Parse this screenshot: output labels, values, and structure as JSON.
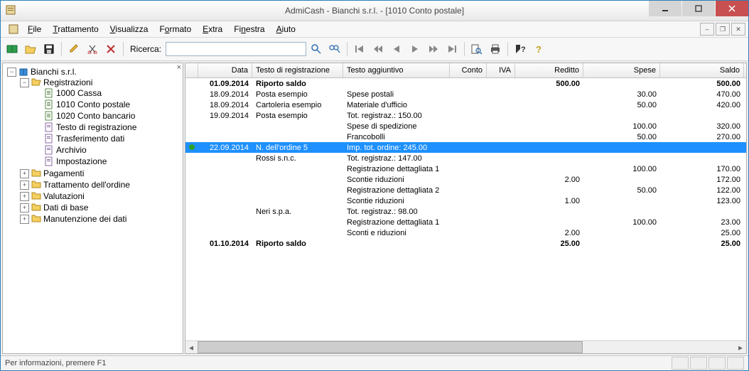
{
  "window": {
    "title": "AdmiCash - Bianchi s.r.l. - [1010 Conto postale]"
  },
  "menu": {
    "file": "File",
    "trattamento": "Trattamento",
    "visualizza": "Visualizza",
    "formato": "Formato",
    "extra": "Extra",
    "finestra": "Finestra",
    "aiuto": "Aiuto"
  },
  "toolbar": {
    "search_label": "Ricerca:",
    "search_value": ""
  },
  "tree": {
    "root": "Bianchi s.r.l.",
    "registrazioni": "Registrazioni",
    "items": [
      "1000 Cassa",
      "1010 Conto postale",
      "1020 Conto bancario",
      "Testo di registrazione",
      "Trasferimento dati",
      "Archivio",
      "Impostazione"
    ],
    "folders": [
      "Pagamenti",
      "Trattamento dell'ordine",
      "Valutazioni",
      "Dati di base",
      "Manutenzione dei dati"
    ]
  },
  "grid": {
    "headers": {
      "data": "Data",
      "testo": "Testo di registrazione",
      "agg": "Testo aggiuntivo",
      "conto": "Conto",
      "iva": "IVA",
      "reditto": "Reditto",
      "spese": "Spese",
      "saldo": "Saldo"
    },
    "rows": [
      {
        "mark": "",
        "data": "01.09.2014",
        "testo": "Riporto saldo",
        "agg": "",
        "conto": "",
        "iva": "",
        "reditto": "500.00",
        "spese": "",
        "saldo": "500.00",
        "bold": true
      },
      {
        "mark": "",
        "data": "18.09.2014",
        "testo": "Posta esempio",
        "agg": "Spese postali",
        "conto": "",
        "iva": "",
        "reditto": "",
        "spese": "30.00",
        "saldo": "470.00"
      },
      {
        "mark": "",
        "data": "18.09.2014",
        "testo": "Cartoleria esempio",
        "agg": "Materiale d'ufficio",
        "conto": "",
        "iva": "",
        "reditto": "",
        "spese": "50.00",
        "saldo": "420.00"
      },
      {
        "mark": "",
        "data": "19.09.2014",
        "testo": "Posta esempio",
        "agg": "Tot. registraz.: 150.00",
        "conto": "",
        "iva": "",
        "reditto": "",
        "spese": "",
        "saldo": ""
      },
      {
        "mark": "",
        "data": "",
        "testo": "",
        "agg": "Spese di spedizione",
        "conto": "",
        "iva": "",
        "reditto": "",
        "spese": "100.00",
        "saldo": "320.00"
      },
      {
        "mark": "",
        "data": "",
        "testo": "",
        "agg": "Francobolli",
        "conto": "",
        "iva": "",
        "reditto": "",
        "spese": "50.00",
        "saldo": "270.00"
      },
      {
        "mark": "dot",
        "data": "22.09.2014",
        "testo": "N. dell'ordine 5",
        "agg": "Imp. tot. ordine: 245.00",
        "conto": "",
        "iva": "",
        "reditto": "",
        "spese": "",
        "saldo": "",
        "sel": true
      },
      {
        "mark": "",
        "data": "",
        "testo": "Rossi s.n.c.",
        "agg": "Tot. registraz.: 147.00",
        "conto": "",
        "iva": "",
        "reditto": "",
        "spese": "",
        "saldo": ""
      },
      {
        "mark": "",
        "data": "",
        "testo": "",
        "agg": "Registrazione dettagliata 1",
        "conto": "",
        "iva": "",
        "reditto": "",
        "spese": "100.00",
        "saldo": "170.00"
      },
      {
        "mark": "",
        "data": "",
        "testo": "",
        "agg": "Scontie riduzioni",
        "conto": "",
        "iva": "",
        "reditto": "2.00",
        "spese": "",
        "saldo": "172.00"
      },
      {
        "mark": "",
        "data": "",
        "testo": "",
        "agg": "Registrazione dettagliata 2",
        "conto": "",
        "iva": "",
        "reditto": "",
        "spese": "50.00",
        "saldo": "122.00"
      },
      {
        "mark": "",
        "data": "",
        "testo": "",
        "agg": "Scontie riduzioni",
        "conto": "",
        "iva": "",
        "reditto": "1.00",
        "spese": "",
        "saldo": "123.00"
      },
      {
        "mark": "",
        "data": "",
        "testo": "Neri s.p.a.",
        "agg": "Tot. registraz.: 98.00",
        "conto": "",
        "iva": "",
        "reditto": "",
        "spese": "",
        "saldo": ""
      },
      {
        "mark": "",
        "data": "",
        "testo": "",
        "agg": "Registrazione dettagliata 1",
        "conto": "",
        "iva": "",
        "reditto": "",
        "spese": "100.00",
        "saldo": "23.00"
      },
      {
        "mark": "",
        "data": "",
        "testo": "",
        "agg": "Sconti e riduzioni",
        "conto": "",
        "iva": "",
        "reditto": "2.00",
        "spese": "",
        "saldo": "25.00"
      },
      {
        "mark": "",
        "data": "01.10.2014",
        "testo": "Riporto saldo",
        "agg": "",
        "conto": "",
        "iva": "",
        "reditto": "25.00",
        "spese": "",
        "saldo": "25.00",
        "bold": true
      }
    ]
  },
  "status": {
    "text": "Per informazioni, premere F1"
  }
}
